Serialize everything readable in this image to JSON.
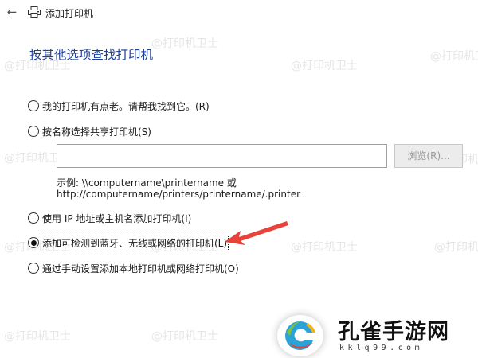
{
  "window": {
    "title": "添加打印机"
  },
  "heading": "按其他选项查找打印机",
  "options": [
    {
      "label": "我的打印机有点老。请帮我找到它。(R)",
      "checked": false
    },
    {
      "label": "按名称选择共享打印机(S)",
      "checked": false
    },
    {
      "label": "使用 IP 地址或主机名添加打印机(I)",
      "checked": false
    },
    {
      "label": "添加可检测到蓝牙、无线或网络的打印机(L)",
      "checked": true
    },
    {
      "label": "通过手动设置添加本地打印机或网络打印机(O)",
      "checked": false
    }
  ],
  "shared_printer": {
    "input_value": "",
    "browse_label": "浏览(R)...",
    "example_line1": "示例: \\\\computername\\printername 或",
    "example_line2": "http://computername/printers/printername/.printer"
  },
  "watermark_text": "@打印机卫士",
  "logo": {
    "name": "孔雀手游网",
    "url": "kklq99.com"
  },
  "colors": {
    "heading": "#1f3f99",
    "arrow": "#e8433a"
  },
  "icons": {
    "back": "arrow-left-icon",
    "printer": "printer-icon"
  }
}
